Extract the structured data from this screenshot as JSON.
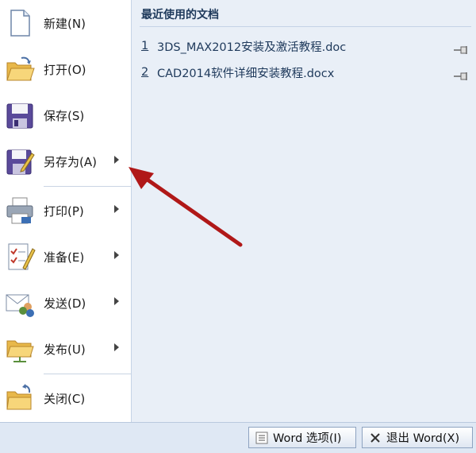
{
  "menu": {
    "items": [
      {
        "label": "新建(N)",
        "icon": "new-document-icon",
        "has_submenu": false
      },
      {
        "label": "打开(O)",
        "icon": "open-folder-icon",
        "has_submenu": false
      },
      {
        "label": "保存(S)",
        "icon": "save-floppy-icon",
        "has_submenu": false
      },
      {
        "label": "另存为(A)",
        "icon": "save-as-icon",
        "has_submenu": true
      },
      {
        "label": "打印(P)",
        "icon": "printer-icon",
        "has_submenu": true
      },
      {
        "label": "准备(E)",
        "icon": "prepare-checklist-icon",
        "has_submenu": true
      },
      {
        "label": "发送(D)",
        "icon": "send-mail-icon",
        "has_submenu": true
      },
      {
        "label": "发布(U)",
        "icon": "publish-folder-icon",
        "has_submenu": true
      },
      {
        "label": "关闭(C)",
        "icon": "close-folder-icon",
        "has_submenu": false
      }
    ]
  },
  "recent": {
    "title": "最近使用的文档",
    "docs": [
      {
        "num": "1",
        "name": "3DS_MAX2012安装及激活教程.doc"
      },
      {
        "num": "2",
        "name": "CAD2014软件详细安装教程.docx"
      }
    ]
  },
  "footer": {
    "options_label": "Word 选项(I)",
    "exit_label": "退出 Word(X)"
  },
  "colors": {
    "arrow": "#b01818",
    "panel": "#e9eff7",
    "title": "#1e395b"
  }
}
